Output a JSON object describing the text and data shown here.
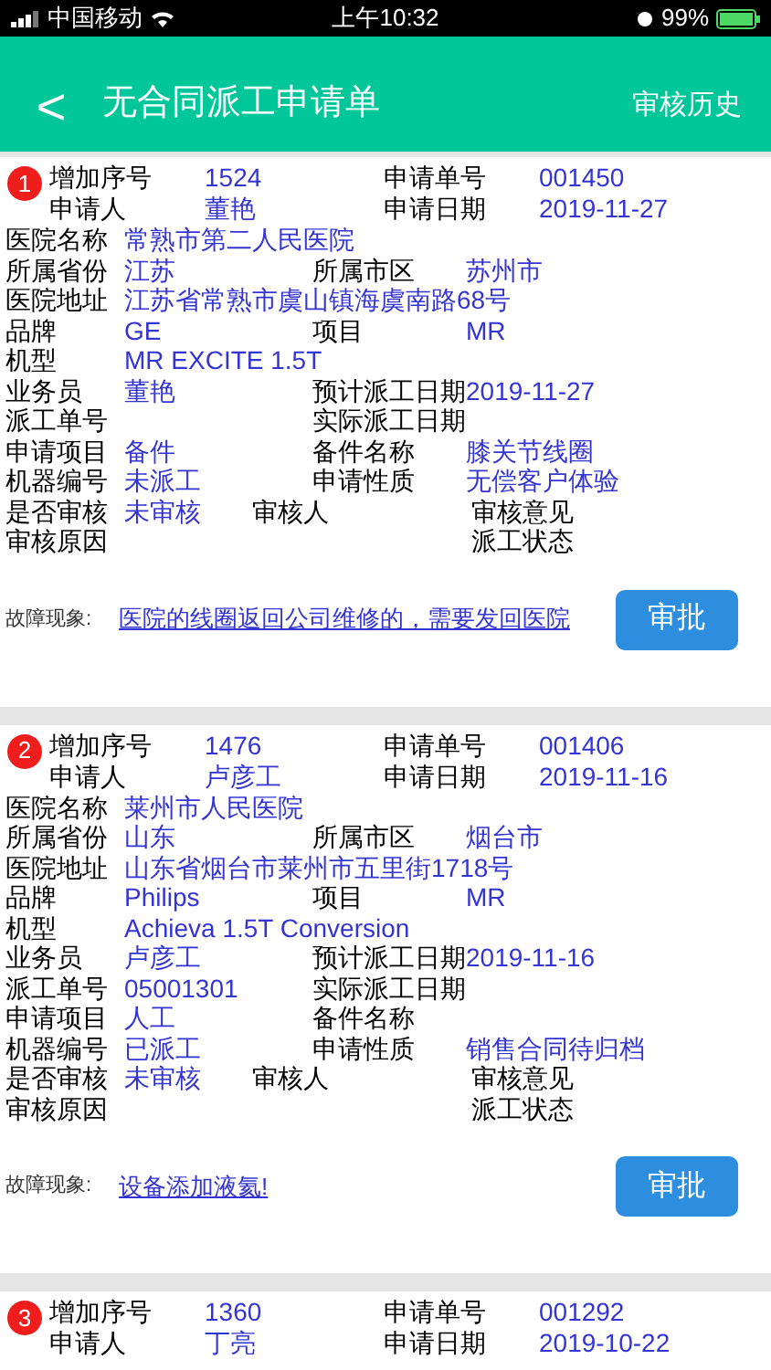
{
  "status_bar": {
    "carrier": "中国移动",
    "time": "上午10:32",
    "battery": "99%"
  },
  "nav": {
    "back": "<",
    "title": "无合同派工申请单",
    "action": "审核历史"
  },
  "cards": [
    {
      "badge": "1",
      "header": [
        {
          "label": "增加序号",
          "value": "1524"
        },
        {
          "label": "申请单号",
          "value": "001450"
        },
        {
          "label": "申请人",
          "value": "董艳"
        },
        {
          "label": "申请日期",
          "value": "2019-11-27"
        }
      ],
      "rows": [
        {
          "kind": "one",
          "cells": [
            {
              "label": "医院名称",
              "value": "常熟市第二人民医院"
            }
          ]
        },
        {
          "kind": "two",
          "cells": [
            {
              "label": "所属省份",
              "value": "江苏"
            },
            {
              "label": "所属市区",
              "value": "苏州市"
            }
          ]
        },
        {
          "kind": "one",
          "cells": [
            {
              "label": "医院地址",
              "value": "江苏省常熟市虞山镇海虞南路68号"
            }
          ]
        },
        {
          "kind": "two",
          "cells": [
            {
              "label": "品牌",
              "value": "GE"
            },
            {
              "label": "项目",
              "value": "MR"
            }
          ]
        },
        {
          "kind": "one",
          "cells": [
            {
              "label": "机型",
              "value": "MR EXCITE 1.5T"
            }
          ]
        },
        {
          "kind": "two",
          "cells": [
            {
              "label": "业务员",
              "value": "董艳"
            },
            {
              "label": "预计派工日期",
              "value": "2019-11-27"
            }
          ]
        },
        {
          "kind": "two",
          "cells": [
            {
              "label": "派工单号"
            },
            {
              "label": "实际派工日期"
            }
          ]
        },
        {
          "kind": "two",
          "cells": [
            {
              "label": "申请项目",
              "value": "备件"
            },
            {
              "label": "备件名称",
              "value": "膝关节线圈"
            }
          ]
        },
        {
          "kind": "two",
          "cells": [
            {
              "label": "机器编号",
              "value": "未派工"
            },
            {
              "label": "申请性质",
              "value": "无偿客户体验"
            }
          ]
        },
        {
          "kind": "three",
          "cells": [
            {
              "label": "是否审核",
              "value": "未审核"
            },
            {
              "label": "审核人"
            },
            {
              "label": "审核意见"
            }
          ]
        },
        {
          "kind": "status",
          "cells": [
            {
              "label": "审核原因"
            },
            {
              "label": "派工状态"
            }
          ]
        }
      ],
      "fault": {
        "label": "故障现象:",
        "text": "医院的线圈返回公司维修的，需要发回医院"
      },
      "button": "审批"
    },
    {
      "badge": "2",
      "header": [
        {
          "label": "增加序号",
          "value": "1476"
        },
        {
          "label": "申请单号",
          "value": "001406"
        },
        {
          "label": "申请人",
          "value": "卢彦工"
        },
        {
          "label": "申请日期",
          "value": "2019-11-16"
        }
      ],
      "rows": [
        {
          "kind": "one",
          "cells": [
            {
              "label": "医院名称",
              "value": "莱州市人民医院"
            }
          ]
        },
        {
          "kind": "two",
          "cells": [
            {
              "label": "所属省份",
              "value": "山东"
            },
            {
              "label": "所属市区",
              "value": "烟台市"
            }
          ]
        },
        {
          "kind": "one",
          "cells": [
            {
              "label": "医院地址",
              "value": "山东省烟台市莱州市五里街1718号"
            }
          ]
        },
        {
          "kind": "two",
          "cells": [
            {
              "label": "品牌",
              "value": "Philips"
            },
            {
              "label": "项目",
              "value": "MR"
            }
          ]
        },
        {
          "kind": "one",
          "cells": [
            {
              "label": "机型",
              "value": "Achieva 1.5T Conversion"
            }
          ]
        },
        {
          "kind": "two",
          "cells": [
            {
              "label": "业务员",
              "value": "卢彦工"
            },
            {
              "label": "预计派工日期",
              "value": "2019-11-16"
            }
          ]
        },
        {
          "kind": "two",
          "cells": [
            {
              "label": "派工单号",
              "value": "05001301"
            },
            {
              "label": "实际派工日期"
            }
          ]
        },
        {
          "kind": "two",
          "cells": [
            {
              "label": "申请项目",
              "value": "人工"
            },
            {
              "label": "备件名称"
            }
          ]
        },
        {
          "kind": "two",
          "cells": [
            {
              "label": "机器编号",
              "value": "已派工"
            },
            {
              "label": "申请性质",
              "value": "销售合同待归档"
            }
          ]
        },
        {
          "kind": "three",
          "cells": [
            {
              "label": "是否审核",
              "value": "未审核"
            },
            {
              "label": "审核人"
            },
            {
              "label": "审核意见"
            }
          ]
        },
        {
          "kind": "status",
          "cells": [
            {
              "label": "审核原因"
            },
            {
              "label": "派工状态"
            }
          ]
        }
      ],
      "fault": {
        "label": "故障现象:",
        "text": "设备添加液氦!"
      },
      "button": "审批"
    },
    {
      "badge": "3",
      "header": [
        {
          "label": "增加序号",
          "value": "1360"
        },
        {
          "label": "申请单号",
          "value": "001292"
        },
        {
          "label": "申请人",
          "value": "丁亮"
        },
        {
          "label": "申请日期",
          "value": "2019-10-22"
        }
      ]
    }
  ]
}
